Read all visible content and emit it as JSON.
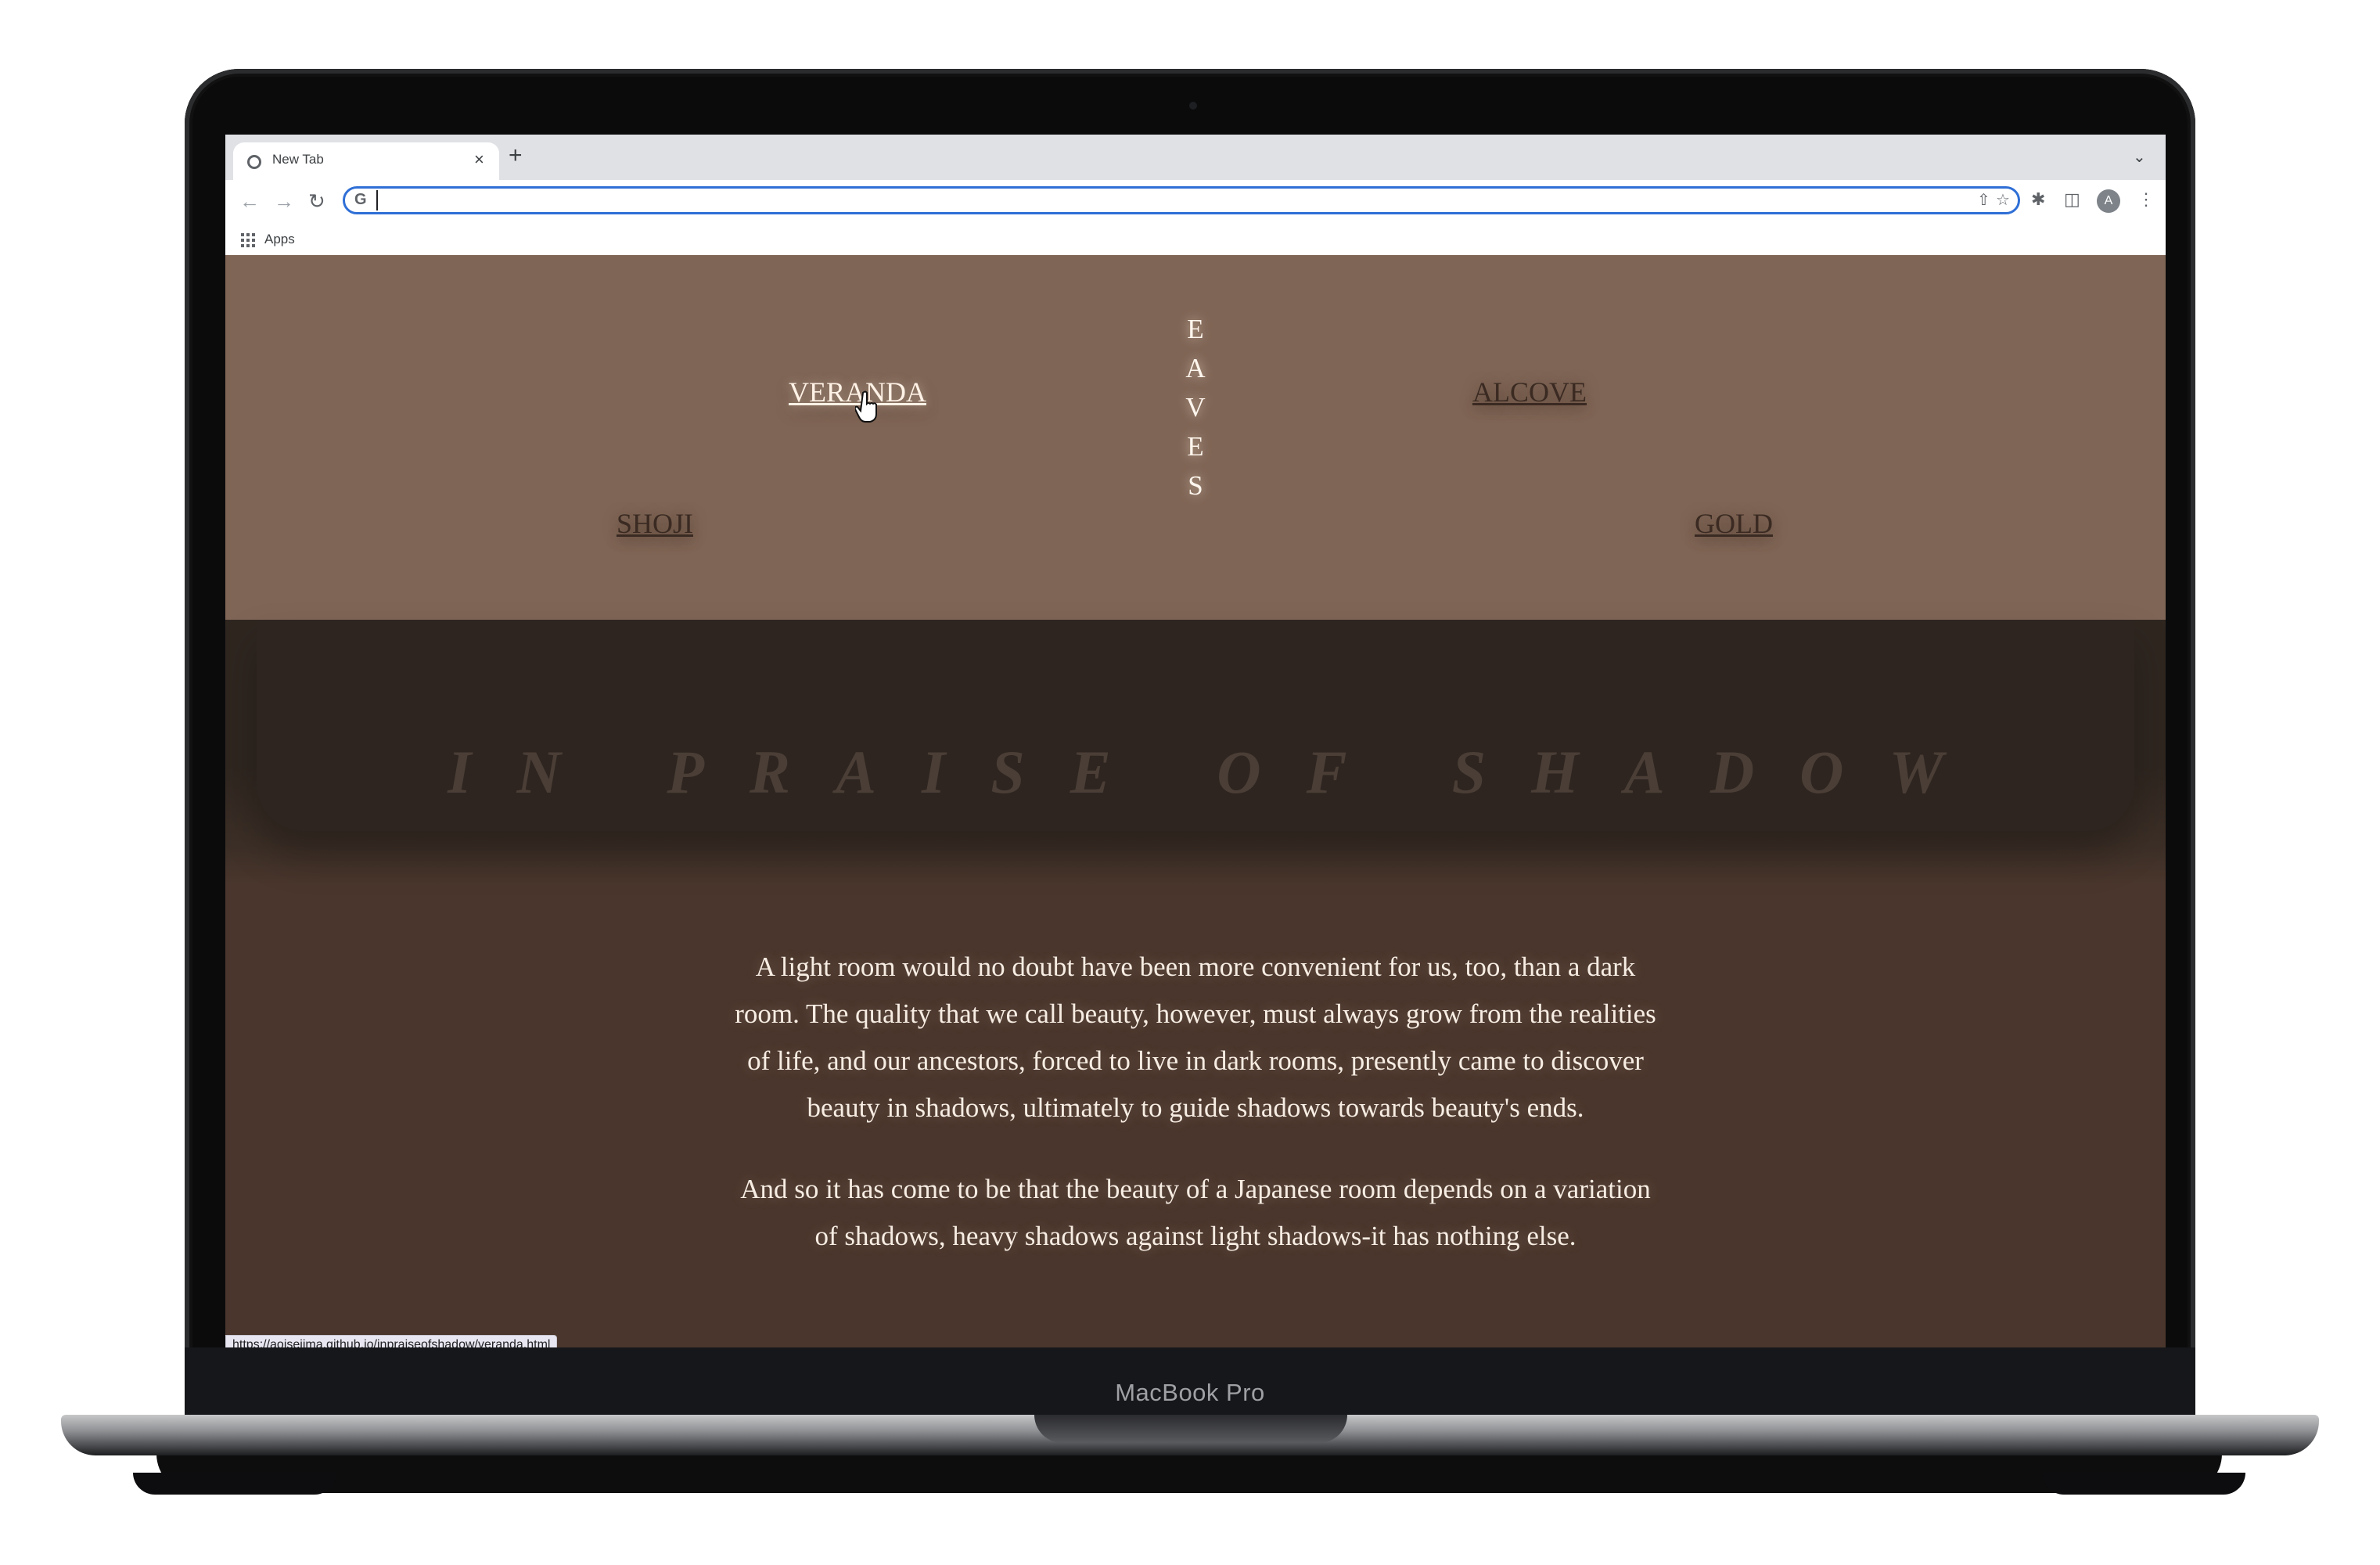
{
  "browser": {
    "tab_title": "New Tab",
    "tab_close": "×",
    "new_tab": "+",
    "omnibox_value": "",
    "bookmarks": {
      "apps_label": "Apps"
    },
    "avatar_letter": "A",
    "status_url": "https://aoisejima.github.io/inpraiseofshadow/veranda.html"
  },
  "device": {
    "label": "MacBook Pro"
  },
  "nav": {
    "veranda": "VERANDA",
    "shoji": "SHOJI",
    "eaves": [
      "E",
      "A",
      "V",
      "E",
      "S"
    ],
    "alcove": "ALCOVE",
    "gold": "GOLD"
  },
  "page": {
    "title": "IN PRAISE OF SHADOW",
    "paragraphs": [
      "A light room would no doubt have been more convenient for us, too, than a dark room. The quality that we call beauty, however, must always grow from the realities of life, and our ancestors, forced to live in dark rooms, presently came to discover beauty in shadows, ultimately to guide shadows towards beauty's ends.",
      "And so it has come to be that the beauty of a Japanese room depends on a variation of shadows, heavy shadows against light shadows-it has nothing else."
    ]
  },
  "colors": {
    "nav_background": "#7f6555",
    "title_band": "#2e2520",
    "content_background": "#4a362c",
    "omnibox_focus": "#2f6fd6"
  }
}
